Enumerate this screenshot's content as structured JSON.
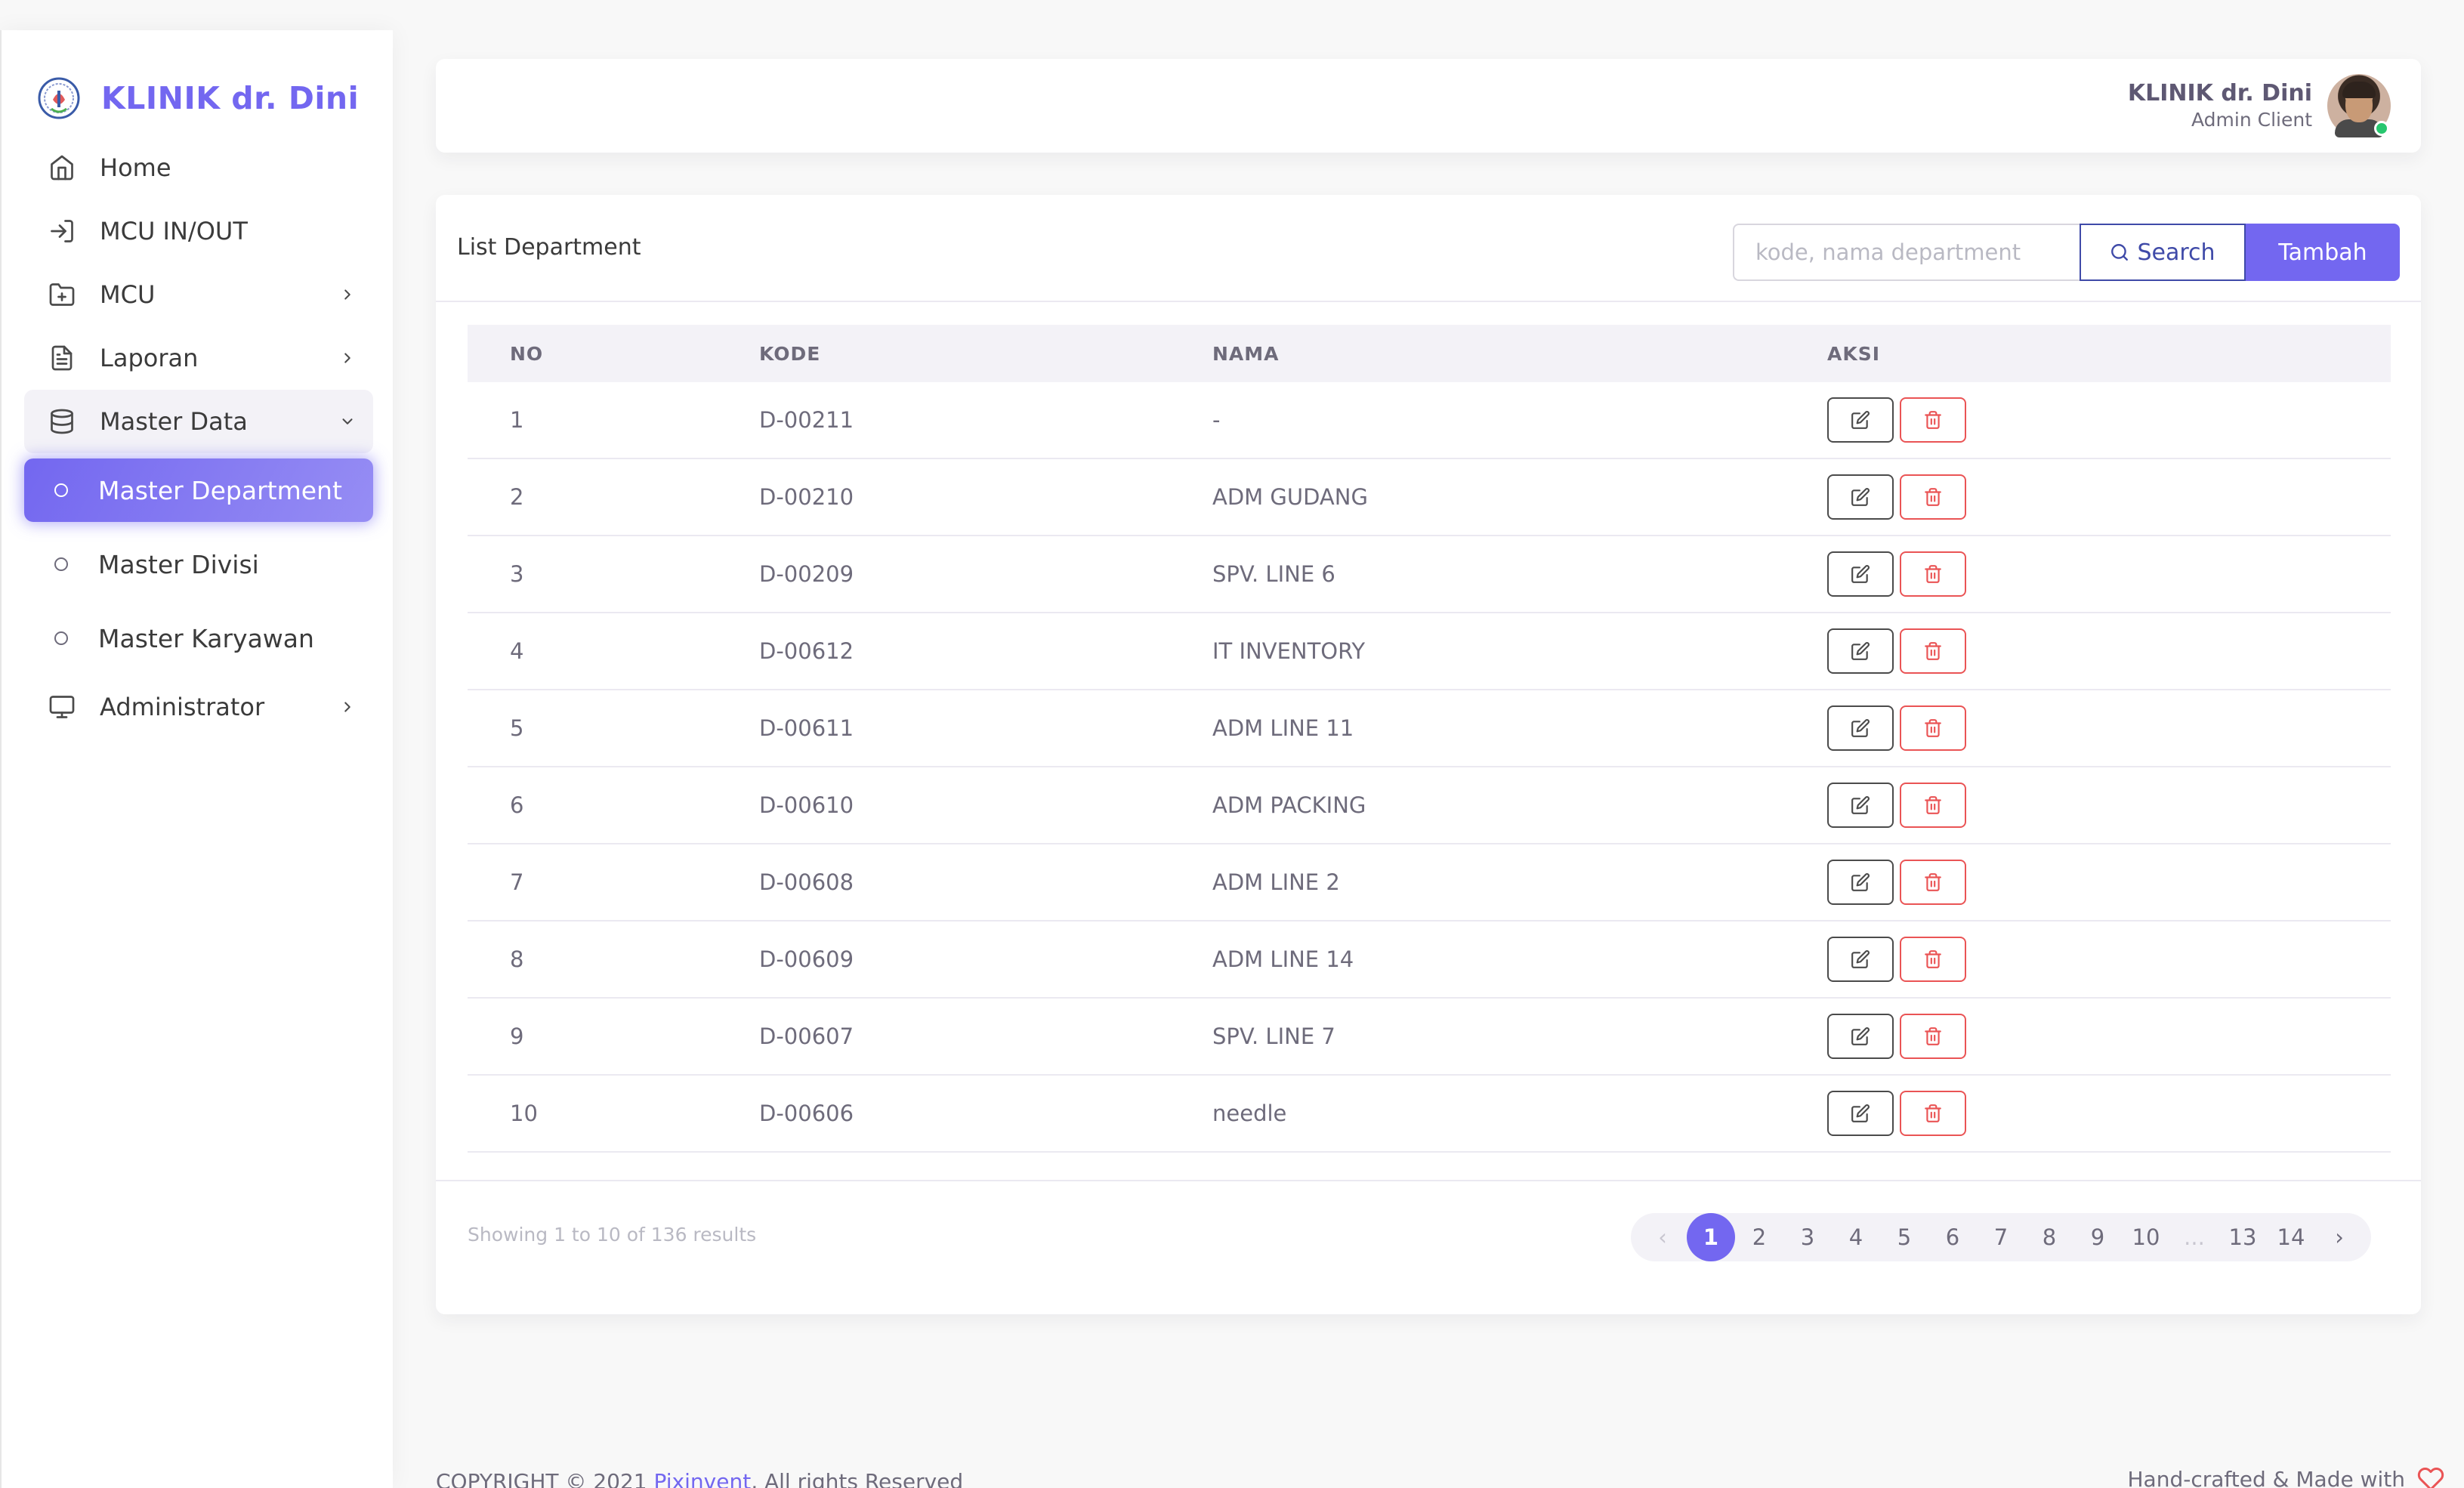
{
  "app": {
    "brand_name": "KLINIK dr. Dini",
    "accent_color": "#7367f0"
  },
  "sidebar": {
    "items": [
      {
        "label": "Home",
        "icon": "home-icon"
      },
      {
        "label": "MCU IN/OUT",
        "icon": "login-icon"
      },
      {
        "label": "MCU",
        "icon": "folder-plus-icon",
        "has_children": true
      },
      {
        "label": "Laporan",
        "icon": "file-text-icon",
        "has_children": true
      },
      {
        "label": "Master Data",
        "icon": "database-icon",
        "expanded": true
      },
      {
        "label": "Administrator",
        "icon": "monitor-icon",
        "has_children": true
      }
    ],
    "sub_items": [
      {
        "label": "Master Department",
        "active": true
      },
      {
        "label": "Master Divisi"
      },
      {
        "label": "Master Karyawan"
      }
    ]
  },
  "header": {
    "user_name": "KLINIK dr. Dini",
    "user_role": "Admin Client",
    "status": "online"
  },
  "card": {
    "title": "List Department",
    "search_placeholder": "kode, nama department",
    "search_label": "Search",
    "add_label": "Tambah"
  },
  "table": {
    "columns": [
      "NO",
      "KODE",
      "NAMA",
      "AKSI"
    ],
    "rows": [
      {
        "no": "1",
        "kode": "D-00211",
        "nama": "-"
      },
      {
        "no": "2",
        "kode": "D-00210",
        "nama": "ADM GUDANG"
      },
      {
        "no": "3",
        "kode": "D-00209",
        "nama": "SPV. LINE 6"
      },
      {
        "no": "4",
        "kode": "D-00612",
        "nama": "IT INVENTORY"
      },
      {
        "no": "5",
        "kode": "D-00611",
        "nama": "ADM LINE 11"
      },
      {
        "no": "6",
        "kode": "D-00610",
        "nama": "ADM PACKING"
      },
      {
        "no": "7",
        "kode": "D-00608",
        "nama": "ADM LINE 2"
      },
      {
        "no": "8",
        "kode": "D-00609",
        "nama": "ADM LINE 14"
      },
      {
        "no": "9",
        "kode": "D-00607",
        "nama": "SPV. LINE 7"
      },
      {
        "no": "10",
        "kode": "D-00606",
        "nama": "needle"
      }
    ]
  },
  "pagination": {
    "summary": "Showing 1 to 10 of 136 results",
    "prev": "‹",
    "next": "›",
    "pages": [
      "1",
      "2",
      "3",
      "4",
      "5",
      "6",
      "7",
      "8",
      "9",
      "10",
      "...",
      "13",
      "14"
    ],
    "current": "1"
  },
  "footer": {
    "copyright_prefix": "COPYRIGHT © 2021",
    "copyright_brand": "Pixinvent",
    "copyright_suffix": ", All rights Reserved",
    "made_with": "Hand-crafted & Made with"
  }
}
